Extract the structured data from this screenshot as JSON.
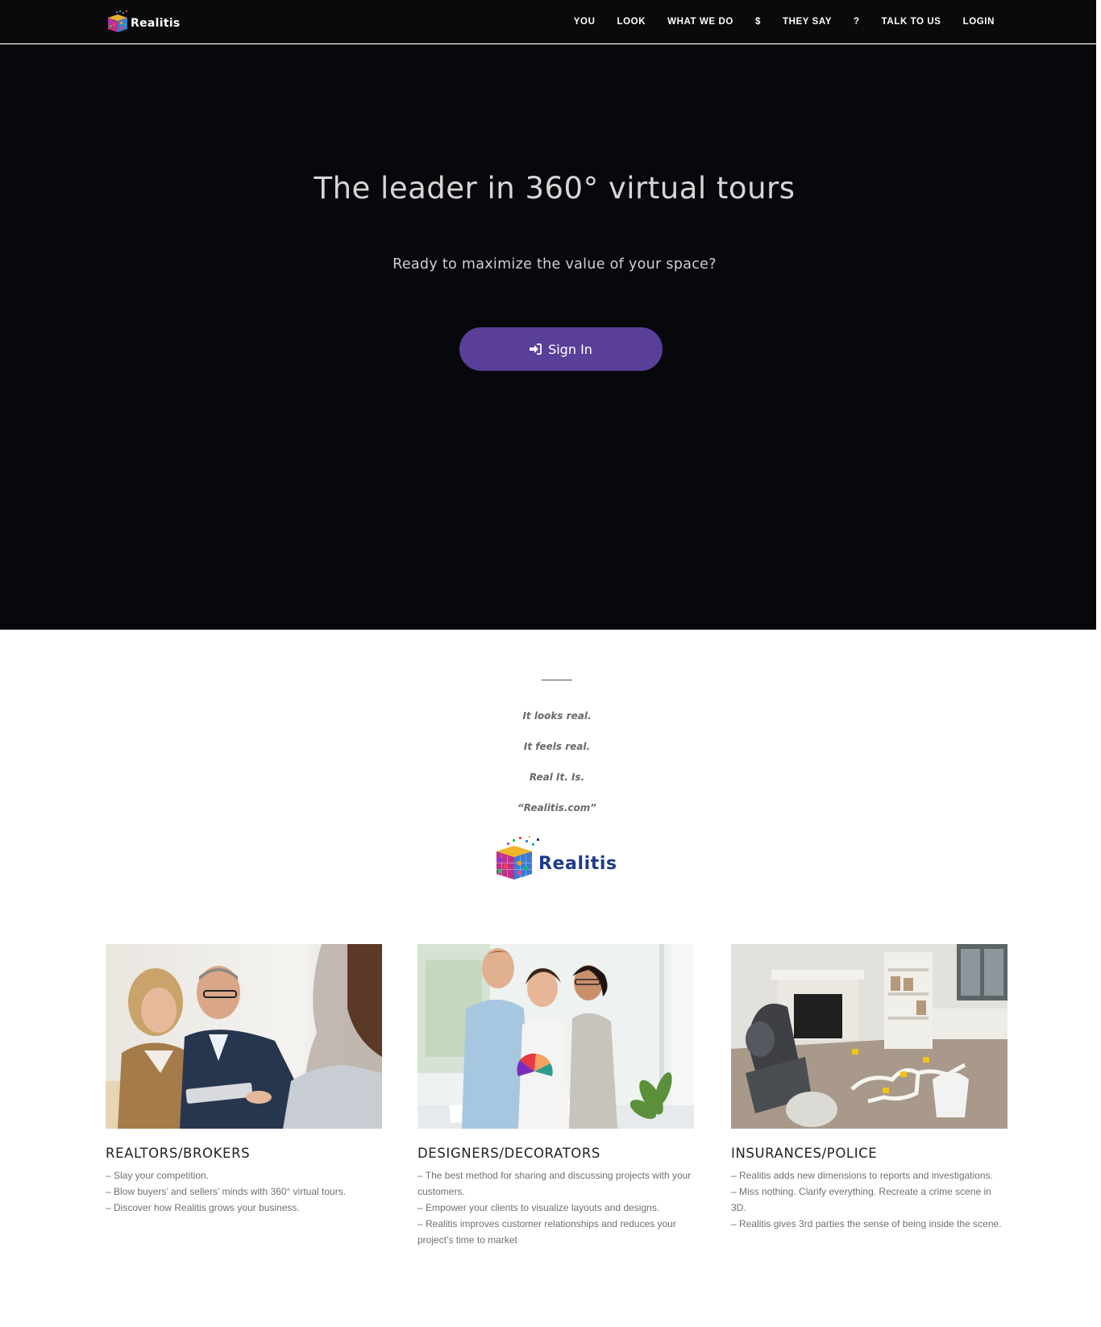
{
  "header": {
    "logo_text": "Realitis",
    "nav": [
      "YOU",
      "LOOK",
      "WHAT WE DO",
      "$",
      "THEY SAY",
      "?",
      "TALK TO US",
      "LOGIN"
    ]
  },
  "hero": {
    "title": "The leader in 360° virtual tours",
    "subtitle": "Ready to maximize the value of your space?",
    "cta_label": "Sign In",
    "cta_color": "#5a3f99",
    "background": "#07080c"
  },
  "tagline": {
    "lines": [
      "It looks real.",
      "It feels real.",
      "Real It. Is.",
      "“Realitis.com”"
    ],
    "logo_text": "Realitis"
  },
  "cards": [
    {
      "title": "REALTORS/BROKERS",
      "bullets": [
        "– Slay your competition.",
        "– Blow buyers’ and sellers’ minds with 360° virtual tours.",
        "– Discover how Realitis grows your business."
      ]
    },
    {
      "title": "DESIGNERS/DECORATORS",
      "bullets": [
        "– The best method for sharing and discussing projects with your customers.",
        "– Empower your clients to visualize layouts and designs.",
        "– Realitis improves customer relationships and reduces your project’s time to market"
      ]
    },
    {
      "title": "INSURANCES/POLICE",
      "bullets": [
        "– Realitis adds new dimensions to reports and investigations.",
        "– Miss nothing. Clarify everything. Recreate a crime scene in 3D.",
        "– Realitis gives 3rd parties the sense of being inside the scene."
      ]
    }
  ]
}
